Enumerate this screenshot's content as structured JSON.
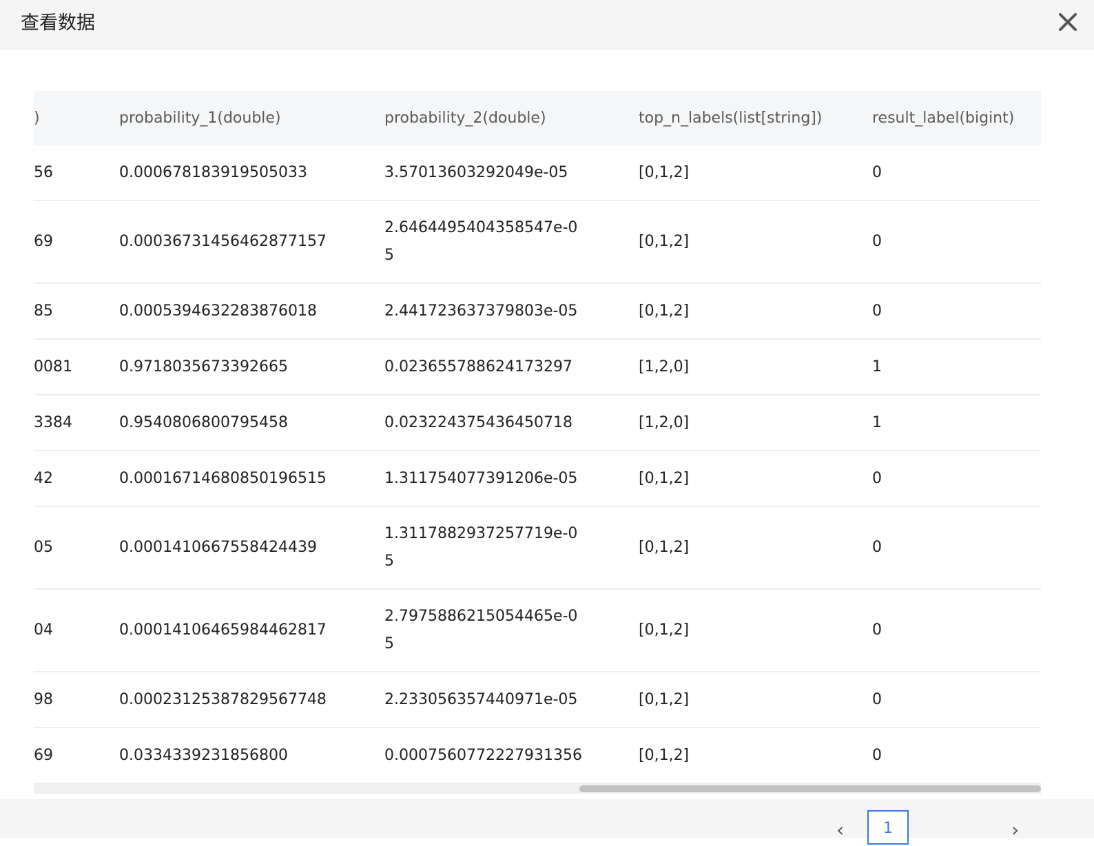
{
  "modal": {
    "title": "查看数据"
  },
  "table": {
    "columns": [
      ")",
      "probability_1(double)",
      "probability_2(double)",
      "top_n_labels(list[string])",
      "result_label(bigint)"
    ],
    "rows": [
      [
        "56",
        "0.000678183919505033",
        "3.57013603292049e-05",
        "[0,1,2]",
        "0"
      ],
      [
        "69",
        "0.00036731456462877157",
        "2.6464495404358547e-05",
        "[0,1,2]",
        "0"
      ],
      [
        "85",
        "0.0005394632283876018",
        "2.441723637379803e-05",
        "[0,1,2]",
        "0"
      ],
      [
        "0081",
        "0.9718035673392665",
        "0.023655788624173297",
        "[1,2,0]",
        "1"
      ],
      [
        "3384",
        "0.9540806800795458",
        "0.023224375436450718",
        "[1,2,0]",
        "1"
      ],
      [
        "42",
        "0.00016714680850196515",
        "1.311754077391206e-05",
        "[0,1,2]",
        "0"
      ],
      [
        "05",
        "0.0001410667558424439",
        "1.3117882937257719e-05",
        "[0,1,2]",
        "0"
      ],
      [
        "04",
        "0.00014106465984462817",
        "2.7975886215054465e-05",
        "[0,1,2]",
        "0"
      ],
      [
        "98",
        "0.00023125387829567748",
        "2.233056357440971e-05",
        "[0,1,2]",
        "0"
      ],
      [
        "69",
        "0.0334339231856800",
        "0.00075607722279313​56",
        "[0,1,2]",
        "0"
      ]
    ]
  },
  "pagination": {
    "prev": "‹",
    "current": "1",
    "next": "›"
  }
}
